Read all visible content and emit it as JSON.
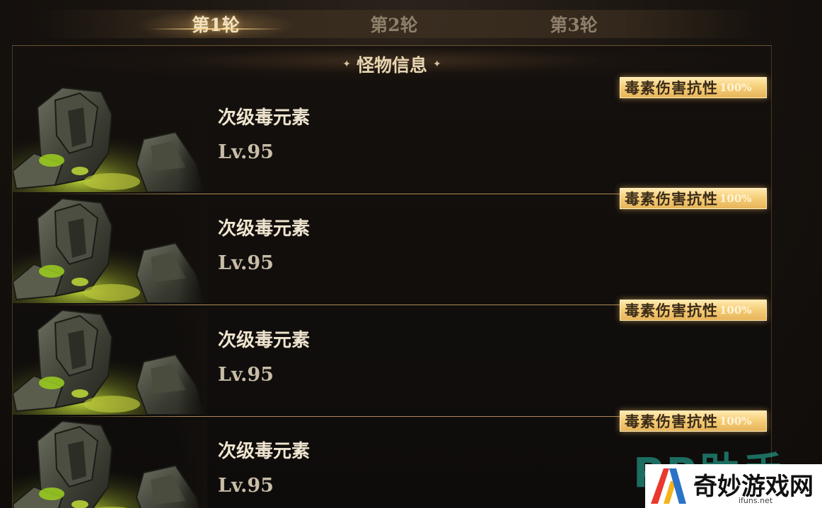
{
  "tabs": [
    {
      "label": "第1轮",
      "active": true
    },
    {
      "label": "第2轮",
      "active": false
    },
    {
      "label": "第3轮",
      "active": false
    }
  ],
  "panel": {
    "title": "怪物信息",
    "title_ornament": "✦"
  },
  "monsters": [
    {
      "name": "次级毒元素",
      "level": "Lv.95",
      "badge_label": "毒素伤害抗性",
      "badge_value": "100%"
    },
    {
      "name": "次级毒元素",
      "level": "Lv.95",
      "badge_label": "毒素伤害抗性",
      "badge_value": "100%"
    },
    {
      "name": "次级毒元素",
      "level": "Lv.95",
      "badge_label": "毒素伤害抗性",
      "badge_value": "100%"
    },
    {
      "name": "次级毒元素",
      "level": "Lv.95",
      "badge_label": "毒素伤害抗性",
      "badge_value": "100%"
    }
  ],
  "watermark": {
    "pp_text": "PP助手",
    "site_name": "奇妙游戏网",
    "site_url": "ifuns.net"
  },
  "colors": {
    "accent_gold": "#f6cf7a",
    "poison_green": "#9ccf1e",
    "background": "#14100d"
  }
}
